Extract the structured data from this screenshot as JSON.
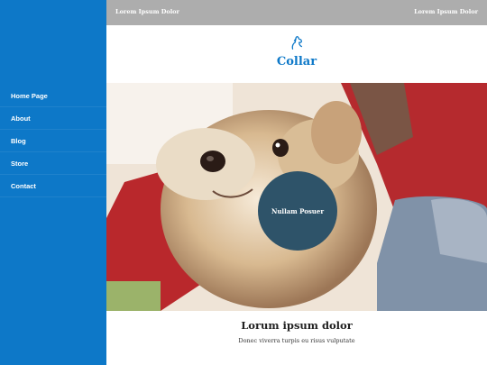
{
  "sidebar": {
    "items": [
      {
        "label": "Home Page"
      },
      {
        "label": "About"
      },
      {
        "label": "Blog"
      },
      {
        "label": "Store"
      },
      {
        "label": "Contact"
      }
    ]
  },
  "topbar": {
    "left_text": "Lorem Ipsum Dolor",
    "right_text": "Lorem Ipsum Dolor"
  },
  "brand": {
    "icon": "dog-head-icon",
    "title": "Collar"
  },
  "hero": {
    "badge_text": "Nullam Posuer"
  },
  "content": {
    "heading": "Lorum ipsum dolor",
    "subtext": "Donec viverra turpis eu risus vulputate"
  },
  "colors": {
    "sidebar": "#0d78c8",
    "topbar": "#adadad",
    "brand_title": "#0d78c8",
    "hero_badge": "#2e5369"
  }
}
